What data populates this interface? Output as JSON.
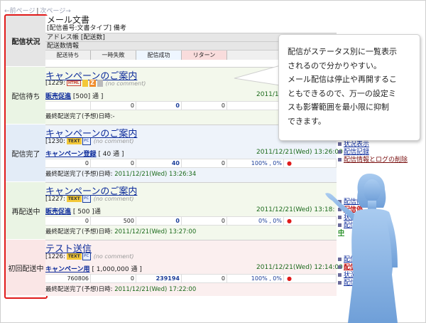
{
  "pager": {
    "prev": "←前ページ",
    "sep": "|",
    "next": "次ページ→"
  },
  "status_column": {
    "header": "配信状況",
    "items": [
      "配信待ち",
      "配信完了",
      "再配送中",
      "初回配送中"
    ]
  },
  "table_header": {
    "title": "メール文書",
    "subtitle": "[配信番号:文書タイプ] 備考",
    "address": "アドレス帳 [配送数]",
    "delivery_info": "配送数情報",
    "columns": [
      "配送待ち",
      "一時失敗",
      "配信成功",
      "リターン"
    ]
  },
  "rows": [
    {
      "title": "キャンペーンのご案内",
      "id": "[1229:",
      "icons": [
        "html-icon",
        "yellow-icon",
        "z-icon",
        "grey-icon"
      ],
      "z_label": "Z",
      "html_label": "HTML",
      "comment": "(no comment)",
      "group": "販売促進",
      "group_count": "[500] 通 ]",
      "date": "2011/12/",
      "nums": [
        "",
        "0",
        "0",
        "0",
        "",
        ""
      ],
      "last_label": "最終配送完了(予想)日時:-",
      "last_date": ""
    },
    {
      "title": "キャンペーンのご案内",
      "id": "[1230:",
      "text_label": "TEXT",
      "pc_label": "PC",
      "comment": "(no comment)",
      "group": "キャンペーン登録",
      "group_count": "[ 40 通 ]",
      "date": "2011/12/21(Wed) 13:26:00",
      "nums": [
        "0",
        "0",
        "40",
        "0",
        "100% , 0%",
        "●"
      ],
      "last_label": "最終配送完了(予想)日時:",
      "last_date": "2011/12/21(Wed) 13:26:34"
    },
    {
      "title": "キャンペーンのご案内",
      "id": "[1227:",
      "text_label": "TEXT",
      "pc_label": "PC",
      "comment": "(no comment)",
      "group": "販売促進",
      "group_count": "[ 500 ]通",
      "date": "2011/12/21(Wed) 13:18:",
      "nums": [
        "0",
        "500",
        "0",
        "0",
        "0% , 0%",
        "●"
      ],
      "last_label": "最終配送完了(予想)日時:",
      "last_date": "2011/12/21(Wed) 13:27:00"
    },
    {
      "title": "テスト送信",
      "id": "[1226:",
      "text_label": "TEXT",
      "pc_label": "PC",
      "comment": "(no comment)",
      "group": "キャンペーン用",
      "group_count": "[ 1,000,000 通 ]",
      "date": "2011/12/21(Wed) 12:14:00",
      "nums": [
        "760806",
        "0",
        "239194",
        "0",
        "100% , 0%",
        "●"
      ],
      "last_label": "最終配送完了(予想)日時:",
      "last_date": "2011/12/21(Wed) 17:22:00"
    }
  ],
  "actions": [
    [
      "状況表示",
      "配信記録",
      "配信情報とログの削除"
    ],
    [
      "配信情報",
      "配信停",
      "状況表示",
      "配信記",
      "中"
    ],
    [
      "配信情",
      "配信",
      "状況",
      "配信"
    ]
  ],
  "bubble": {
    "lines": [
      "配信がステータス別に一覧表示",
      "されるので分かりやすい。",
      "メール配信は停止や再開するこ",
      "ともできるので、万一の設定ミ",
      "スも影響範囲を最小限に抑制",
      "できます。"
    ]
  },
  "colors": {
    "red_frame": "#e01a1a",
    "link_blue": "#0b2a9a",
    "date_green": "#1b6a1b",
    "figure_blue": "#8fb8e6"
  }
}
